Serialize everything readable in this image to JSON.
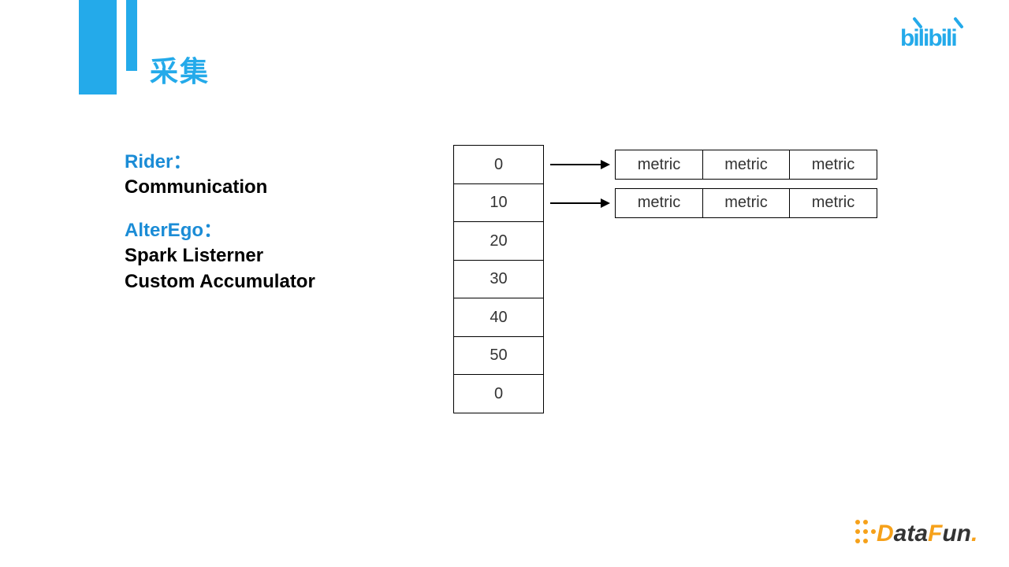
{
  "title": "采集",
  "left": {
    "rider_label": "Rider：",
    "rider_sub": "Communication",
    "alterego_label": "AlterEgo：",
    "alterego_sub1": "Spark Listerner",
    "alterego_sub2": "Custom Accumulator"
  },
  "stack": [
    "0",
    "10",
    "20",
    "30",
    "40",
    "50",
    "0"
  ],
  "metric_rows": [
    {
      "labels": [
        "metric",
        "metric",
        "metric"
      ]
    },
    {
      "labels": [
        "metric",
        "metric",
        "metric"
      ]
    }
  ],
  "logos": {
    "top_right": "bilibili",
    "bottom_right": "DataFun."
  }
}
